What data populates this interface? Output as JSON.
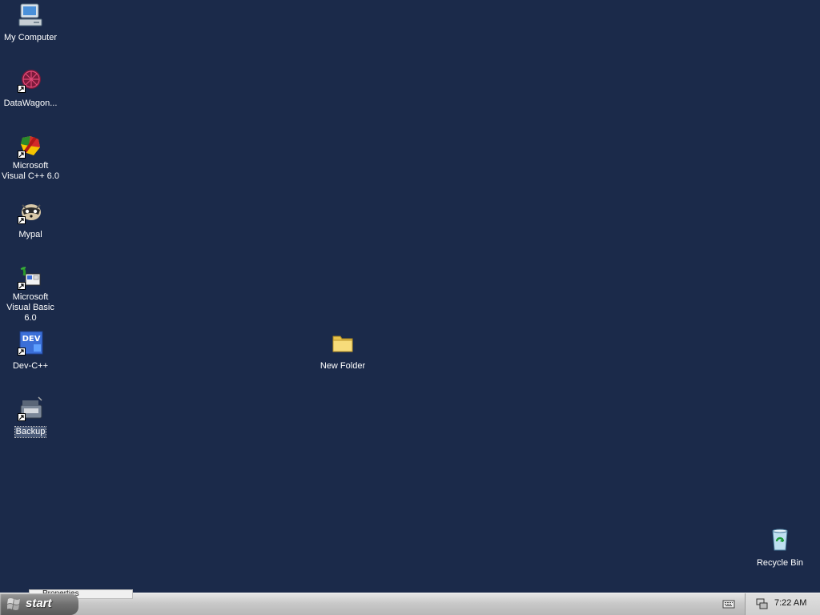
{
  "desktop": {
    "background_color": "#1b2a4a",
    "icons": [
      {
        "label": "My Computer",
        "icon": "computer-icon",
        "shortcut": false
      },
      {
        "label": "DataWagon...",
        "icon": "datawagon-icon",
        "shortcut": true
      },
      {
        "label": "Microsoft Visual C++ 6.0",
        "icon": "visual-cpp-icon",
        "shortcut": true
      },
      {
        "label": "Mypal",
        "icon": "mypal-icon",
        "shortcut": true
      },
      {
        "label": "Microsoft Visual Basic 6.0",
        "icon": "visual-basic-icon",
        "shortcut": true
      },
      {
        "label": "Dev-C++",
        "icon": "dev-cpp-icon",
        "shortcut": true
      },
      {
        "label": "Backup",
        "icon": "backup-icon",
        "shortcut": true,
        "selected": true
      },
      {
        "label": "New Folder",
        "icon": "folder-icon",
        "shortcut": false
      },
      {
        "label": "Recycle Bin",
        "icon": "recycle-bin-icon",
        "shortcut": false
      }
    ]
  },
  "taskbar": {
    "start_label": "start",
    "task_ghost_label": "Properties",
    "clock": "7:22 AM",
    "tray_icons": [
      "keyboard-icon",
      "network-icon"
    ]
  }
}
